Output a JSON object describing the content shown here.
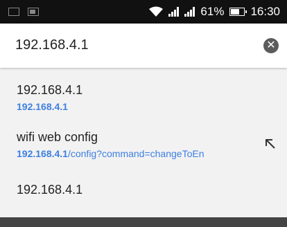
{
  "status_bar": {
    "battery": "61%",
    "time": "16:30",
    "icons": [
      "notification-square-icon",
      "image-icon",
      "wifi-icon",
      "signal-icon",
      "signal2-icon",
      "battery-icon"
    ]
  },
  "address_bar": {
    "value": "192.168.4.1",
    "clear_icon": "clear-circle-icon"
  },
  "suggestions": [
    {
      "title": "192.168.4.1",
      "url_bold": "192.168.4.1",
      "url_rest": ""
    },
    {
      "title": "wifi web config",
      "url_bold": "192.168.4.1",
      "url_rest": "/config?command=changeToEn",
      "action_icon": "refine-arrow-icon"
    },
    {
      "title": "192.168.4.1"
    }
  ],
  "colors": {
    "status_bar": "#111111",
    "link": "#3d7fe2",
    "suggestion_bg": "#f2f2f2"
  }
}
